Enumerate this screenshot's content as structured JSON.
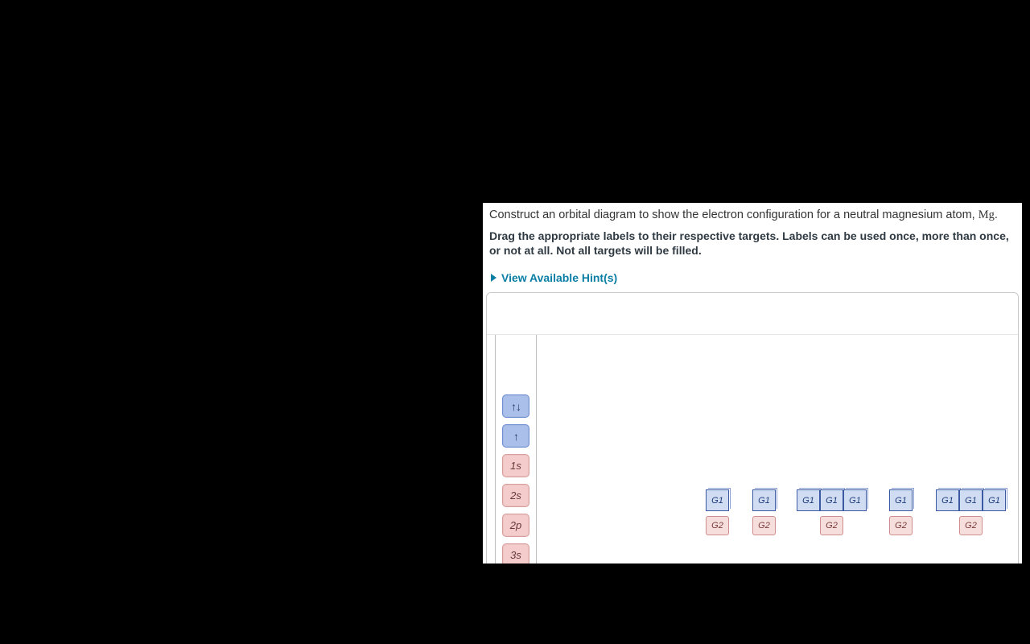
{
  "prompt": {
    "text_before": "Construct an orbital diagram to show the electron configuration for a neutral magnesium atom, ",
    "element": "Mg",
    "text_after": "."
  },
  "instructions": "Drag the appropriate labels to their respective targets. Labels can be used once, more than once, or not at all. Not all targets will be filled.",
  "hints_label": "View Available Hint(s)",
  "palette": {
    "updown": "↑↓",
    "up": "↑",
    "s1": "1s",
    "s2": "2s",
    "p2": "2p",
    "s3": "3s"
  },
  "slot_text": {
    "g1": "G1",
    "g2": "G2"
  },
  "groups": [
    {
      "id": "g1",
      "g1_count": 1
    },
    {
      "id": "g2",
      "g1_count": 1
    },
    {
      "id": "g3",
      "g1_count": 3
    },
    {
      "id": "g4",
      "g1_count": 1
    },
    {
      "id": "g5",
      "g1_count": 3
    }
  ]
}
